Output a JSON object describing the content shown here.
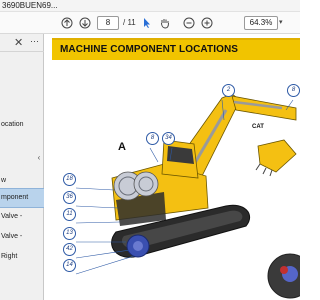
{
  "window": {
    "title": "3690BUEN69..."
  },
  "toolbar": {
    "up_icon": "arrow-up-circle-icon",
    "down_icon": "arrow-down-circle-icon",
    "current_page": "8",
    "total_pages": "/ 11",
    "zoom": "64.3%"
  },
  "sidebar": {
    "items": [
      {
        "label": "ocation"
      },
      {
        "label": "w"
      },
      {
        "label": "mponent"
      },
      {
        "label": "Valve -"
      },
      {
        "label": "Valve -"
      },
      {
        "label": "Right"
      }
    ]
  },
  "document": {
    "title": "MACHINE COMPONENT LOCATIONS",
    "callouts": [
      "2",
      "8",
      "8",
      "34",
      "18",
      "36",
      "11",
      "13",
      "42",
      "14"
    ],
    "letter_a": "A",
    "brand": "CAT"
  },
  "colors": {
    "header_yellow": "#f1c400",
    "machine_yellow": "#f4c012",
    "callout_blue": "#2e5aa6"
  }
}
